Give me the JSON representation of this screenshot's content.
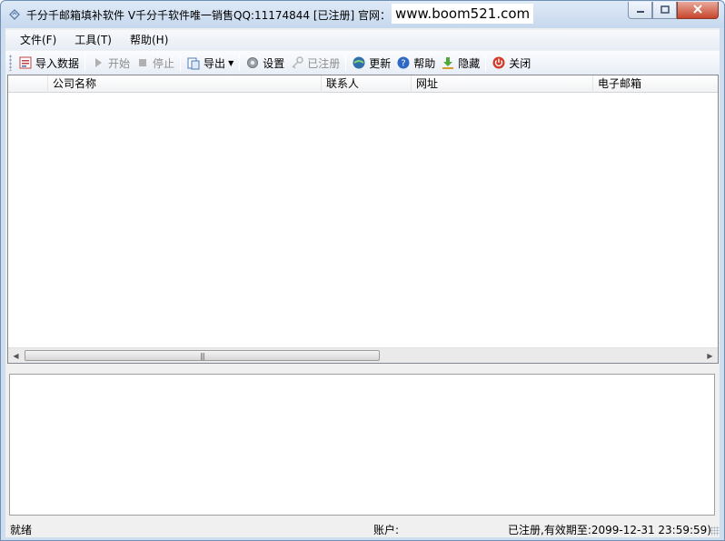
{
  "window": {
    "title": "千分千邮箱填补软件 V千分千软件唯一销售QQ:11174844 [已注册] 官网：",
    "website": "www.boom521.com"
  },
  "menu": [
    {
      "label": "文件(F)"
    },
    {
      "label": "工具(T)"
    },
    {
      "label": "帮助(H)"
    }
  ],
  "toolbar": {
    "import": "导入数据",
    "start": "开始",
    "stop": "停止",
    "export": "导出",
    "settings": "设置",
    "registered": "已注册",
    "update": "更新",
    "help": "帮助",
    "hide": "隐藏",
    "close": "关闭"
  },
  "grid": {
    "columns": [
      "公司名称",
      "联系人",
      "网址",
      "电子邮箱"
    ],
    "rows": []
  },
  "status": {
    "state": "就绪",
    "account": "账户:",
    "license": "已注册,有效期至:2099-12-31 23:59:59)"
  },
  "colors": {
    "title_bar": "#c6d8ee",
    "client_bg": "#f0f0f0",
    "close_button": "#c7462c"
  }
}
